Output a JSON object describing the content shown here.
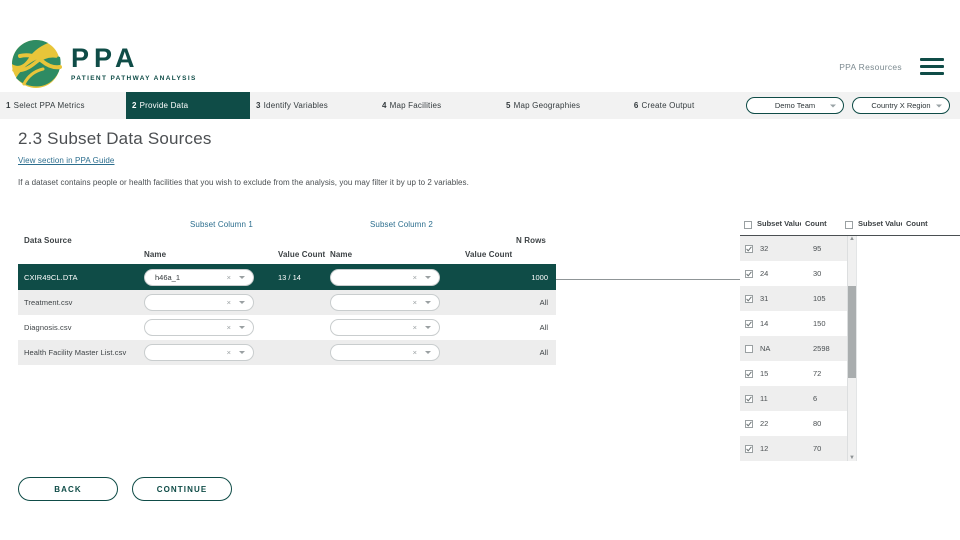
{
  "header": {
    "logo_title": "PPA",
    "logo_subtitle": "PATIENT PATHWAY ANALYSIS",
    "resources_label": "PPA Resources"
  },
  "stepnav": {
    "steps": [
      {
        "num": "1",
        "label": "Select PPA Metrics",
        "active": false
      },
      {
        "num": "2",
        "label": "Provide Data",
        "active": true
      },
      {
        "num": "3",
        "label": "Identify Variables",
        "active": false
      },
      {
        "num": "4",
        "label": "Map Facilities",
        "active": false
      },
      {
        "num": "5",
        "label": "Map Geographies",
        "active": false
      },
      {
        "num": "6",
        "label": "Create Output",
        "active": false
      }
    ],
    "team_select": "Demo Team",
    "region_select": "Country X Region"
  },
  "page": {
    "title": "2.3 Subset Data Sources",
    "guide_link": "View section in PPA Guide",
    "intro": "If a dataset contains people or health facilities that you wish to exclude from the analysis, you may filter it by up to 2 variables."
  },
  "table": {
    "group_headers": {
      "subset_column_1": "Subset Column 1",
      "subset_column_2": "Subset Column 2"
    },
    "columns": {
      "data_source": "Data Source",
      "name_1": "Name",
      "value_count_1": "Value Count",
      "name_2": "Name",
      "value_count_2": "Value Count",
      "n_rows": "N Rows"
    },
    "clear_icon": "×",
    "rows": [
      {
        "data_source": "CXIR49CL.DTA",
        "select_1": "h46a_1",
        "value_count_1": "13 / 14",
        "select_2": "",
        "value_count_2": "",
        "n_rows": "1000",
        "selected": true
      },
      {
        "data_source": "Treatment.csv",
        "select_1": "",
        "value_count_1": "",
        "select_2": "",
        "value_count_2": "",
        "n_rows": "All",
        "selected": false
      },
      {
        "data_source": "Diagnosis.csv",
        "select_1": "",
        "value_count_1": "",
        "select_2": "",
        "value_count_2": "",
        "n_rows": "All",
        "selected": false
      },
      {
        "data_source": "Health Facility Master List.csv",
        "select_1": "",
        "value_count_1": "",
        "select_2": "",
        "value_count_2": "",
        "n_rows": "All",
        "selected": false
      }
    ]
  },
  "popup": {
    "header_1_value": "Subset Value",
    "header_1_count": "Count",
    "header_2_value": "Subset Value",
    "header_2_count": "Count",
    "options": [
      {
        "value": "32",
        "count": "95",
        "checked": true
      },
      {
        "value": "24",
        "count": "30",
        "checked": true
      },
      {
        "value": "31",
        "count": "105",
        "checked": true
      },
      {
        "value": "14",
        "count": "150",
        "checked": true
      },
      {
        "value": "NA",
        "count": "2598",
        "checked": false
      },
      {
        "value": "15",
        "count": "72",
        "checked": true
      },
      {
        "value": "11",
        "count": "6",
        "checked": true
      },
      {
        "value": "22",
        "count": "80",
        "checked": true
      },
      {
        "value": "12",
        "count": "70",
        "checked": true
      }
    ]
  },
  "footer": {
    "back_label": "BACK",
    "continue_label": "CONTINUE"
  },
  "colors": {
    "brand_dark": "#0f4c47",
    "link_blue": "#2c6e8e",
    "nav_bg": "#f2f2f2",
    "logo_yellow": "#e8c53a",
    "logo_green": "#2e8b63"
  }
}
